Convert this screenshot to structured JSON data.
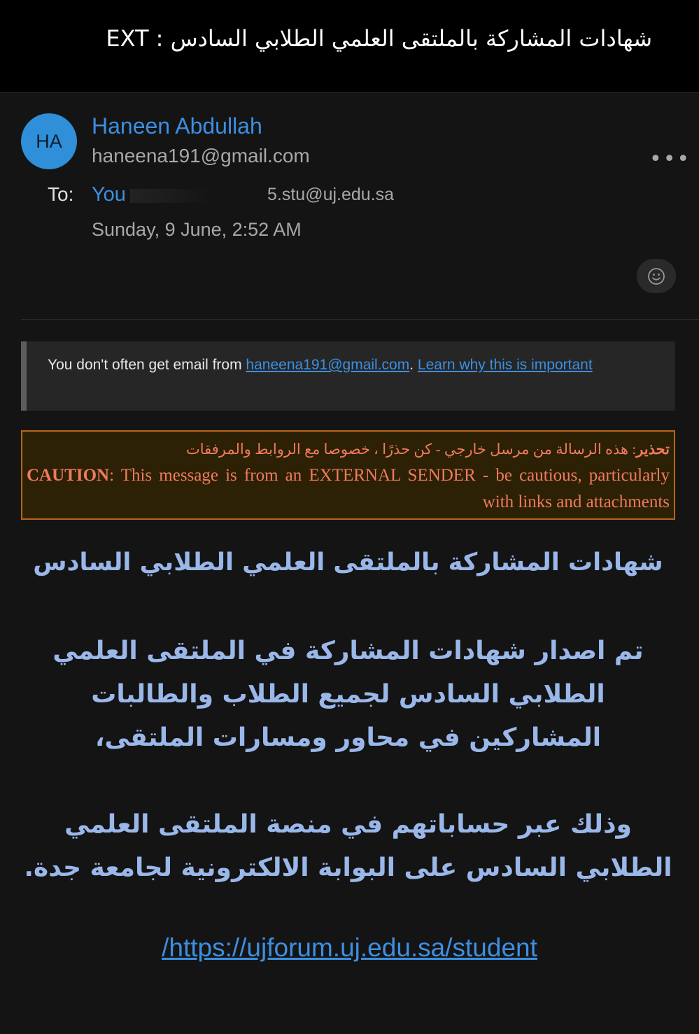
{
  "header": {
    "subject": "شهادات المشاركة بالملتقى العلمي الطلابي السادس : EXT"
  },
  "sender": {
    "initials": "HA",
    "name": "Haneen Abdullah",
    "email": "haneena191@gmail.com",
    "more_icon": "more-horizontal-icon"
  },
  "recipient": {
    "label": "To:",
    "you_label": "You",
    "address_partial": "5.stu@uj.edu.sa"
  },
  "date": "Sunday, 9 June, 2:52 AM",
  "reaction_icon": "smiley-icon",
  "notice": {
    "text_before": "You don't often get email from ",
    "email_link": "haneena191@gmail.com",
    "separator": ". ",
    "learn_link": "Learn why this is important"
  },
  "caution": {
    "ar_label": "تحذير",
    "ar_text": ": هذه الرسالة من مرسل خارجي - كن حذرًا ، خصوصا مع الروابط والمرفقات",
    "en_label": "CAUTION",
    "en_text": ": This message is from an EXTERNAL SENDER - be cautious, particularly with links and attachments",
    "border_color": "#b5651d",
    "text_color": "#f07a5e"
  },
  "body": {
    "heading": "شهادات المشاركة بالملتقى العلمي الطلابي السادس",
    "paragraph1": "تم اصدار شهادات المشاركة في الملتقى العلمي الطلابي السادس لجميع الطلاب والطالبات المشاركين في محاور ومسارات الملتقى،",
    "paragraph2": "وذلك عبر حساباتهم في منصة الملتقى العلمي الطلابي السادس على البوابة الالكترونية لجامعة جدة.",
    "link": "https://ujforum.uj.edu.sa/student/",
    "text_color": "#9ab7ea",
    "link_color": "#3d8fe0"
  }
}
